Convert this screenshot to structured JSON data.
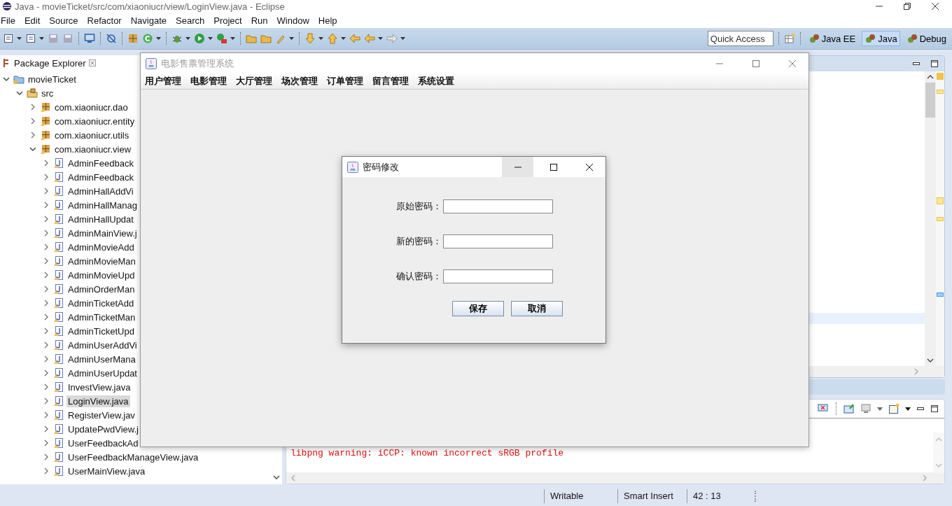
{
  "ide": {
    "title": "Java - movieTicket/src/com/xiaoniucr/view/LoginView.java - Eclipse",
    "menu": [
      "File",
      "Edit",
      "Source",
      "Refactor",
      "Navigate",
      "Search",
      "Project",
      "Run",
      "Window",
      "Help"
    ],
    "quick_access": {
      "placeholder": "Quick Access"
    },
    "perspectives": [
      {
        "label": "Java EE",
        "selected": false
      },
      {
        "label": "Java",
        "selected": true
      },
      {
        "label": "Debug",
        "selected": false
      }
    ],
    "package_explorer": {
      "title": "Package Explorer",
      "tree": [
        {
          "label": "movieTicket",
          "kind": "project",
          "expanded": true,
          "selected": false,
          "children": [
            {
              "label": "src",
              "kind": "folder",
              "expanded": true,
              "selected": false,
              "children": [
                {
                  "label": "com.xiaoniucr.dao",
                  "kind": "package",
                  "expanded": false,
                  "selected": false
                },
                {
                  "label": "com.xiaoniucr.entity",
                  "kind": "package",
                  "expanded": false,
                  "selected": false
                },
                {
                  "label": "com.xiaoniucr.utils",
                  "kind": "package",
                  "expanded": false,
                  "selected": false
                },
                {
                  "label": "com.xiaoniucr.view",
                  "kind": "package",
                  "expanded": true,
                  "selected": false,
                  "children": [
                    {
                      "label": "AdminFeedback",
                      "kind": "file",
                      "expanded": false,
                      "selected": false
                    },
                    {
                      "label": "AdminFeedback",
                      "kind": "file",
                      "expanded": false,
                      "selected": false
                    },
                    {
                      "label": "AdminHallAddVi",
                      "kind": "file",
                      "expanded": false,
                      "selected": false
                    },
                    {
                      "label": "AdminHallManag",
                      "kind": "file",
                      "expanded": false,
                      "selected": false
                    },
                    {
                      "label": "AdminHallUpdat",
                      "kind": "file",
                      "expanded": false,
                      "selected": false
                    },
                    {
                      "label": "AdminMainView.j",
                      "kind": "file",
                      "expanded": false,
                      "selected": false
                    },
                    {
                      "label": "AdminMovieAdd",
                      "kind": "file",
                      "expanded": false,
                      "selected": false
                    },
                    {
                      "label": "AdminMovieMan",
                      "kind": "file",
                      "expanded": false,
                      "selected": false
                    },
                    {
                      "label": "AdminMovieUpd",
                      "kind": "file",
                      "expanded": false,
                      "selected": false
                    },
                    {
                      "label": "AdminOrderMan",
                      "kind": "file",
                      "expanded": false,
                      "selected": false
                    },
                    {
                      "label": "AdminTicketAdd",
                      "kind": "file",
                      "expanded": false,
                      "selected": false
                    },
                    {
                      "label": "AdminTicketMan",
                      "kind": "file",
                      "expanded": false,
                      "selected": false
                    },
                    {
                      "label": "AdminTicketUpd",
                      "kind": "file",
                      "expanded": false,
                      "selected": false
                    },
                    {
                      "label": "AdminUserAddVi",
                      "kind": "file",
                      "expanded": false,
                      "selected": false
                    },
                    {
                      "label": "AdminUserMana",
                      "kind": "file",
                      "expanded": false,
                      "selected": false
                    },
                    {
                      "label": "AdminUserUpdat",
                      "kind": "file",
                      "expanded": false,
                      "selected": false
                    },
                    {
                      "label": "InvestView.java",
                      "kind": "file",
                      "expanded": false,
                      "selected": false
                    },
                    {
                      "label": "LoginView.java",
                      "kind": "file",
                      "expanded": false,
                      "selected": true
                    },
                    {
                      "label": "RegisterView.jav",
                      "kind": "file",
                      "expanded": false,
                      "selected": false
                    },
                    {
                      "label": "UpdatePwdView.j",
                      "kind": "file",
                      "expanded": false,
                      "selected": false
                    },
                    {
                      "label": "UserFeedbackAd",
                      "kind": "file",
                      "expanded": false,
                      "selected": false
                    },
                    {
                      "label": "UserFeedbackManageView.java",
                      "kind": "file",
                      "expanded": false,
                      "selected": false
                    },
                    {
                      "label": "UserMainView.java",
                      "kind": "file",
                      "expanded": false,
                      "selected": false
                    }
                  ]
                }
              ]
            }
          ]
        }
      ]
    },
    "console": {
      "lines": [
        "libpng warning: iCCP: known incorrect sRGB profile"
      ]
    },
    "status_bar": [
      "Writable",
      "Smart Insert",
      "42 : 13"
    ]
  },
  "app_window": {
    "title": "电影售票管理系统",
    "menu": [
      "用户管理",
      "电影管理",
      "大厅管理",
      "场次管理",
      "订单管理",
      "留言管理",
      "系统设置"
    ]
  },
  "dialog": {
    "title": "密码修改",
    "fields": [
      {
        "label": "原始密码："
      },
      {
        "label": "新的密码："
      },
      {
        "label": "确认密码："
      }
    ],
    "buttons": [
      "保存",
      "取消"
    ]
  }
}
